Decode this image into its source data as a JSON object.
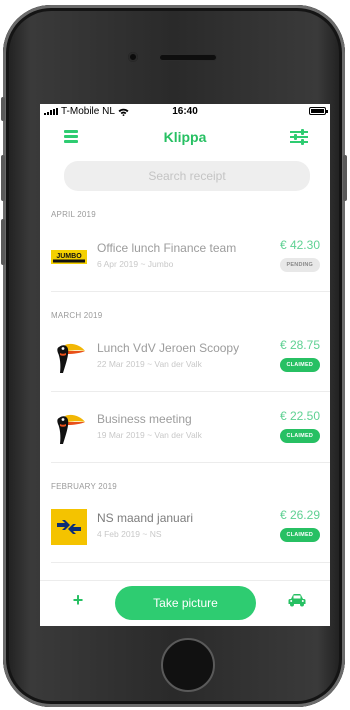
{
  "status_bar": {
    "carrier": "T-Mobile NL",
    "time": "16:40"
  },
  "header": {
    "title": "Klippa"
  },
  "search": {
    "placeholder": "Search receipt"
  },
  "sections": [
    {
      "heading": "APRIL 2019",
      "receipts": [
        {
          "title": "Office lunch Finance team",
          "subtitle": "6 Apr 2019 ~ Jumbo",
          "amount": "€ 42.30",
          "status": "PENDING",
          "logo": "jumbo-logo"
        }
      ]
    },
    {
      "heading": "MARCH 2019",
      "receipts": [
        {
          "title": "Lunch VdV Jeroen Scoopy",
          "subtitle": "22 Mar 2019 ~ Van der Valk",
          "amount": "€ 28.75",
          "status": "CLAIMED",
          "logo": "van-der-valk-toucan-logo"
        },
        {
          "title": "Business meeting",
          "subtitle": "19 Mar 2019 ~ Van der Valk",
          "amount": "€ 22.50",
          "status": "CLAIMED",
          "logo": "van-der-valk-toucan-logo"
        }
      ]
    },
    {
      "heading": "FEBRUARY 2019",
      "receipts": [
        {
          "title": "NS maand januari",
          "subtitle": "4 Feb 2019 ~ NS",
          "amount": "€ 26.29",
          "status": "CLAIMED",
          "logo": "ns-logo"
        }
      ]
    }
  ],
  "bottom_bar": {
    "add_icon": "plus-icon",
    "take_picture_label": "Take picture",
    "car_icon": "car-icon"
  },
  "colors": {
    "accent": "#2ecc71",
    "accent_dark": "#27c063",
    "amount": "#5fd193",
    "pending_badge": "#e8e8e8"
  }
}
